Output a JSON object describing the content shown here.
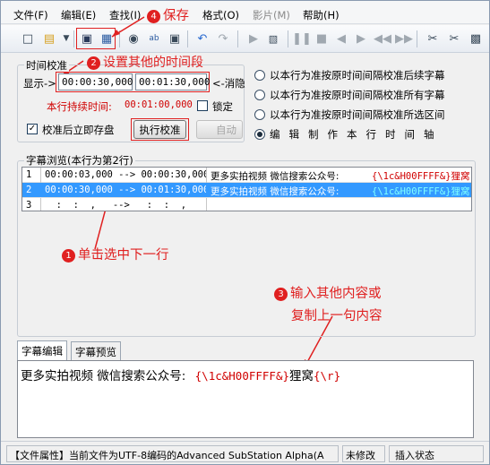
{
  "menu": {
    "file": "文件(F)",
    "edit": "编辑(E)",
    "find": "查找(I)",
    "format": "格式(O)",
    "video": "影片(M)",
    "help": "帮助(H)"
  },
  "timing": {
    "group_title": "时间校准",
    "display_label": "显示->",
    "start_time": "00:00:30,000",
    "end_time": "00:01:30,000",
    "cancel_label": "<-消隐",
    "duration_label": "本行持续时间:",
    "duration_value": "00:01:00,000",
    "lock_label": "锁定",
    "save_after_label": "校准后立即存盘",
    "execute_button": "执行校准",
    "auto_label": "自动",
    "radio_options": [
      "以本行为准按原时间间隔校准后续字幕",
      "以本行为准按原时间间隔校准所有字幕",
      "以本行为准按原时间间隔校准所选区间",
      "编辑制作本行时间轴"
    ],
    "radio_selected_index": 3
  },
  "browse": {
    "group_title": "字幕浏览(本行为第2行)",
    "rows": [
      {
        "num": "1",
        "time": "00:00:03,000 --> 00:00:30,000",
        "text": "更多实拍视频 微信搜索公众号:",
        "tag": "{\\1c&H00FFFF&}狸窝"
      },
      {
        "num": "2",
        "time": "00:00:30,000 --> 00:01:30,000",
        "text": "更多实拍视频 微信搜索公众号:",
        "tag": "{\\1c&H00FFFF&}狸窝"
      },
      {
        "num": "3",
        "time": "  :  :  ,   -->   :  :  ,",
        "text": "",
        "tag": ""
      }
    ]
  },
  "editor": {
    "tab_edit": "字幕编辑",
    "tab_preview": "字幕预览",
    "text": "更多实拍视频 微信搜索公众号:",
    "tag": "{\\1c&H00FFFF&}",
    "tail": "狸窝",
    "tag_end": "{\\r}"
  },
  "status": {
    "file_info": "【文件属性】当前文件为UTF-8编码的Advanced SubStation Alpha(A",
    "modified": "未修改",
    "mode": "插入状态"
  },
  "annotations": {
    "a4_num": "4",
    "a4": "保存",
    "a2_num": "2",
    "a2": "设置其他的时间段",
    "a1_num": "1",
    "a1": "单击选中下一行",
    "a3_num": "3",
    "a3_line1": "输入其他内容或",
    "a3_line2": "复制上一句内容"
  }
}
